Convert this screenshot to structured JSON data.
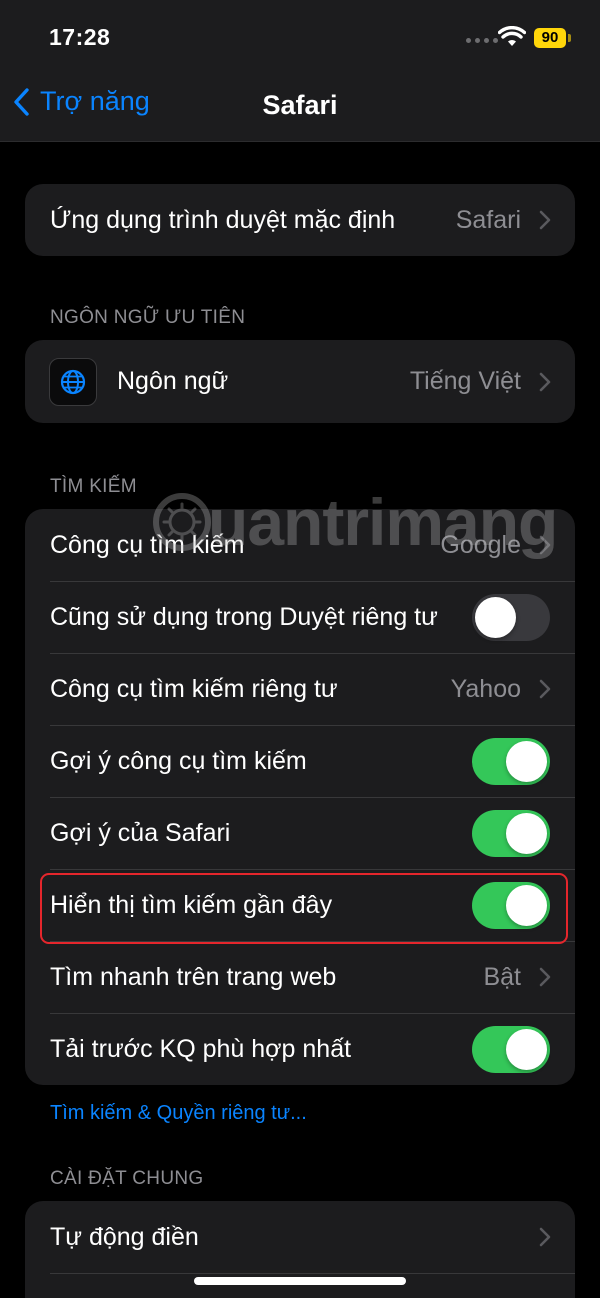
{
  "status_bar": {
    "time": "17:28",
    "battery": "90"
  },
  "nav": {
    "back_label": "Trợ năng",
    "title": "Safari"
  },
  "default_browser": {
    "label": "Ứng dụng trình duyệt mặc định",
    "value": "Safari"
  },
  "language_section": {
    "header": "NGÔN NGỮ ƯU TIÊN",
    "item": {
      "label": "Ngôn ngữ",
      "value": "Tiếng Việt",
      "icon": "globe-icon"
    }
  },
  "search_section": {
    "header": "TÌM KIẾM",
    "rows": [
      {
        "label": "Công cụ tìm kiếm",
        "value": "Google",
        "type": "link"
      },
      {
        "label": "Cũng sử dụng trong Duyệt riêng tư",
        "type": "toggle",
        "on": false
      },
      {
        "label": "Công cụ tìm kiếm riêng tư",
        "value": "Yahoo",
        "type": "link"
      },
      {
        "label": "Gợi ý công cụ tìm kiếm",
        "type": "toggle",
        "on": true
      },
      {
        "label": "Gợi ý của Safari",
        "type": "toggle",
        "on": true
      },
      {
        "label": "Hiển thị tìm kiếm gần đây",
        "type": "toggle",
        "on": true
      },
      {
        "label": "Tìm nhanh trên trang web",
        "value": "Bật",
        "type": "link"
      },
      {
        "label": "Tải trước KQ phù hợp nhất",
        "type": "toggle",
        "on": true
      }
    ],
    "footer_link": "Tìm kiếm & Quyền riêng tư..."
  },
  "general_section": {
    "header": "CÀI ĐẶT CHUNG",
    "rows": [
      {
        "label": "Tự động điền",
        "type": "link"
      }
    ]
  },
  "watermark": "uantrimang",
  "colors": {
    "accent": "#0a84ff",
    "toggle_on": "#34c759",
    "highlight": "#e5262c",
    "battery": "#ffd60a"
  }
}
